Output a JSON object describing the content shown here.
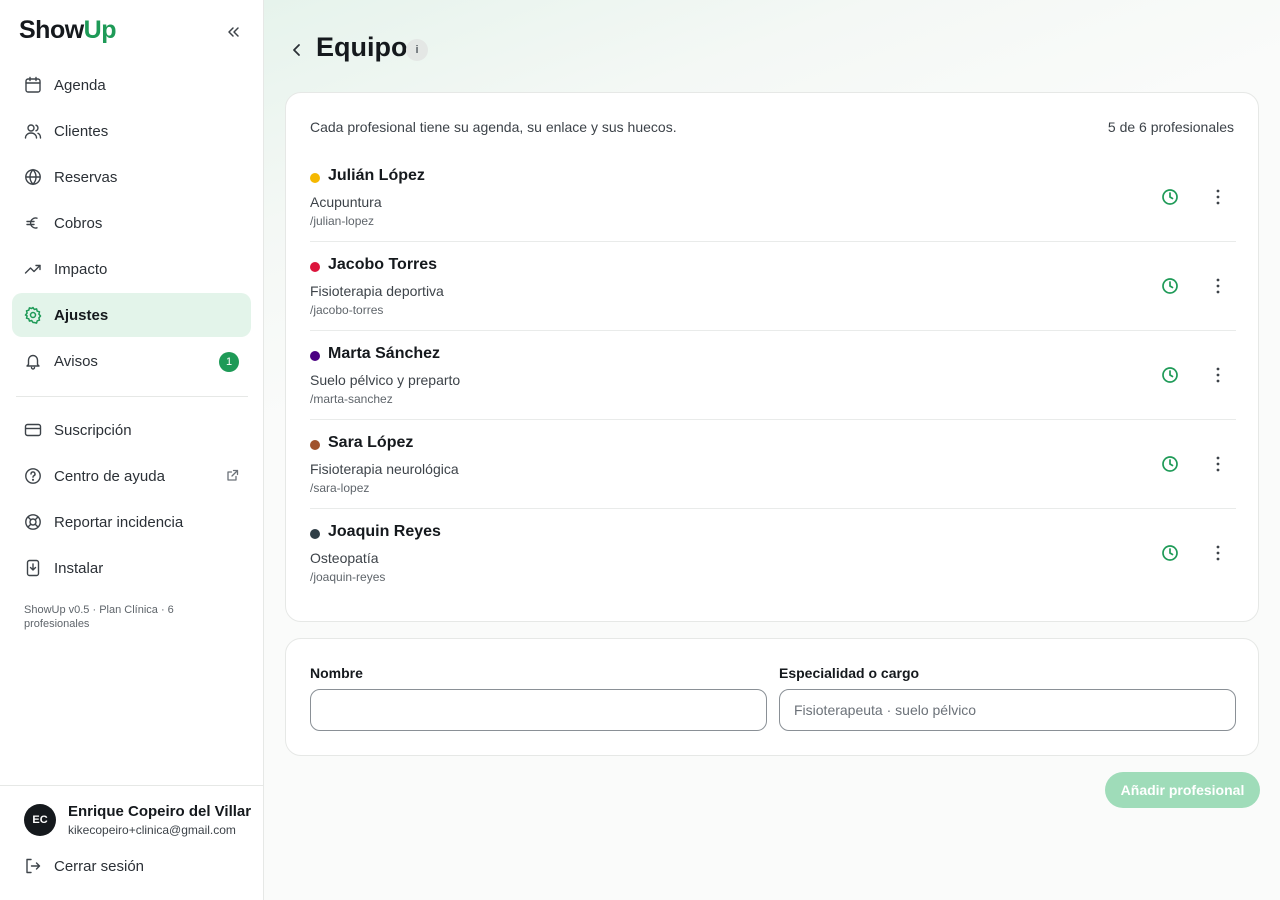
{
  "app": {
    "logo_prefix": "Show",
    "logo_suffix": "Up",
    "brand_color": "#1e9a57"
  },
  "sidebar": {
    "items": [
      {
        "label": "Agenda",
        "icon": "calendar-icon"
      },
      {
        "label": "Clientes",
        "icon": "users-icon"
      },
      {
        "label": "Reservas",
        "icon": "globe-icon"
      },
      {
        "label": "Cobros",
        "icon": "euro-icon"
      },
      {
        "label": "Impacto",
        "icon": "trending-up-icon"
      },
      {
        "label": "Ajustes",
        "icon": "gear-icon",
        "active": true
      },
      {
        "label": "Avisos",
        "icon": "bell-icon",
        "badge": "1"
      }
    ],
    "secondary_items": [
      {
        "label": "Suscripción",
        "icon": "credit-card-icon"
      },
      {
        "label": "Centro de ayuda",
        "icon": "help-circle-icon",
        "external": true
      },
      {
        "label": "Reportar incidencia",
        "icon": "lifebuoy-icon"
      },
      {
        "label": "Instalar",
        "icon": "install-icon"
      }
    ],
    "version": "ShowUp v0.5 · Plan Clínica · 6 profesionales",
    "user": {
      "initials": "EC",
      "name": "Enrique Copeiro del Villar",
      "email": "kikecopeiro+clinica@gmail.com"
    },
    "logout_label": "Cerrar sesión"
  },
  "page": {
    "title": "Equipo",
    "info_label": "i"
  },
  "team": {
    "description": "Cada profesional tiene su agenda, su enlace y sus huecos.",
    "count": "5 de 6 profesionales",
    "members": [
      {
        "name": "Julián López",
        "specialty": "Acupuntura",
        "slug": "/julian-lopez",
        "color": "#f5b800"
      },
      {
        "name": "Jacobo Torres",
        "specialty": "Fisioterapia deportiva",
        "slug": "/jacobo-torres",
        "color": "#dc143c"
      },
      {
        "name": "Marta Sánchez",
        "specialty": "Suelo pélvico y preparto",
        "slug": "/marta-sanchez",
        "color": "#4b0082"
      },
      {
        "name": "Sara López",
        "specialty": "Fisioterapia neurológica",
        "slug": "/sara-lopez",
        "color": "#a0522d"
      },
      {
        "name": "Joaquin Reyes",
        "specialty": "Osteopatía",
        "slug": "/joaquin-reyes",
        "color": "#2f3e46"
      }
    ]
  },
  "form": {
    "name_label": "Nombre",
    "name_value": "",
    "name_placeholder": "",
    "specialty_label": "Especialidad o cargo",
    "specialty_placeholder": "Fisioterapeuta · suelo pélvico",
    "submit_label": "Añadir profesional"
  }
}
